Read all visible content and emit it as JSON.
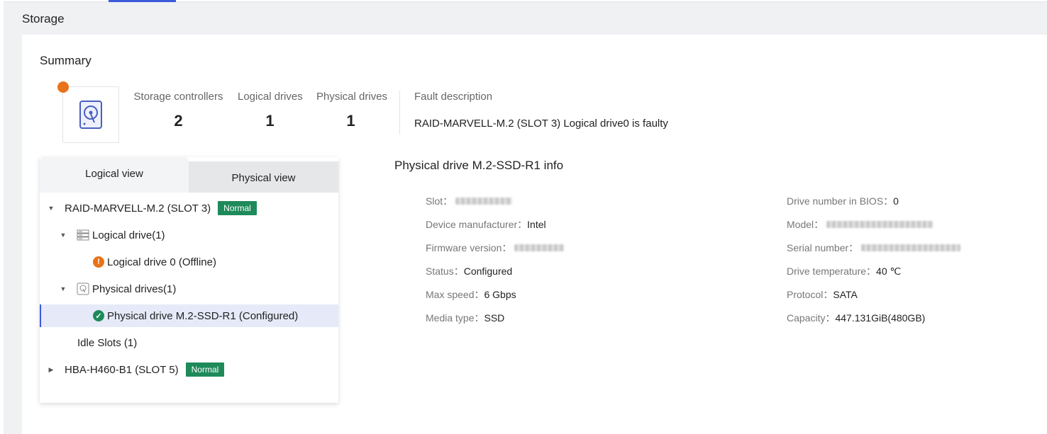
{
  "page": {
    "title": "Storage"
  },
  "summary": {
    "title": "Summary",
    "stats": [
      {
        "label": "Storage controllers",
        "value": "2"
      },
      {
        "label": "Logical drives",
        "value": "1"
      },
      {
        "label": "Physical drives",
        "value": "1"
      }
    ],
    "fault_label": "Fault description",
    "fault_text": "RAID-MARVELL-M.2 (SLOT 3) Logical drive0 is faulty"
  },
  "tree": {
    "tabs": [
      "Logical view",
      "Physical view"
    ],
    "controller1": {
      "label": "RAID-MARVELL-M.2 (SLOT 3)",
      "badge": "Normal"
    },
    "logical_group": "Logical drive(1)",
    "logical_drive": "Logical drive 0 (Offline)",
    "physical_group": "Physical drives(1)",
    "physical_drive": "Physical drive M.2-SSD-R1 (Configured)",
    "idle_slots": "Idle Slots (1)",
    "controller2": {
      "label": "HBA-H460-B1 (SLOT 5)",
      "badge": "Normal"
    }
  },
  "info": {
    "title": "Physical drive M.2-SSD-R1 info",
    "left": [
      {
        "key": "Slot：",
        "value": ""
      },
      {
        "key": "Device manufacturer：",
        "value": "Intel"
      },
      {
        "key": "Firmware version：",
        "value": ""
      },
      {
        "key": "Status：",
        "value": "Configured"
      },
      {
        "key": "Max speed：",
        "value": "6 Gbps"
      },
      {
        "key": "Media type：",
        "value": "SSD"
      }
    ],
    "right": [
      {
        "key": "Drive number in BIOS：",
        "value": "0"
      },
      {
        "key": "Model：",
        "value": ""
      },
      {
        "key": "Serial number：",
        "value": ""
      },
      {
        "key": "Drive temperature：",
        "value": "40 ℃"
      },
      {
        "key": "Protocol：",
        "value": "SATA"
      },
      {
        "key": "Capacity：",
        "value": "447.131GiB(480GB)"
      }
    ]
  },
  "colors": {
    "accent": "#3b5bdb",
    "normal_badge": "#1e8a5a",
    "warning": "#e8731a"
  }
}
